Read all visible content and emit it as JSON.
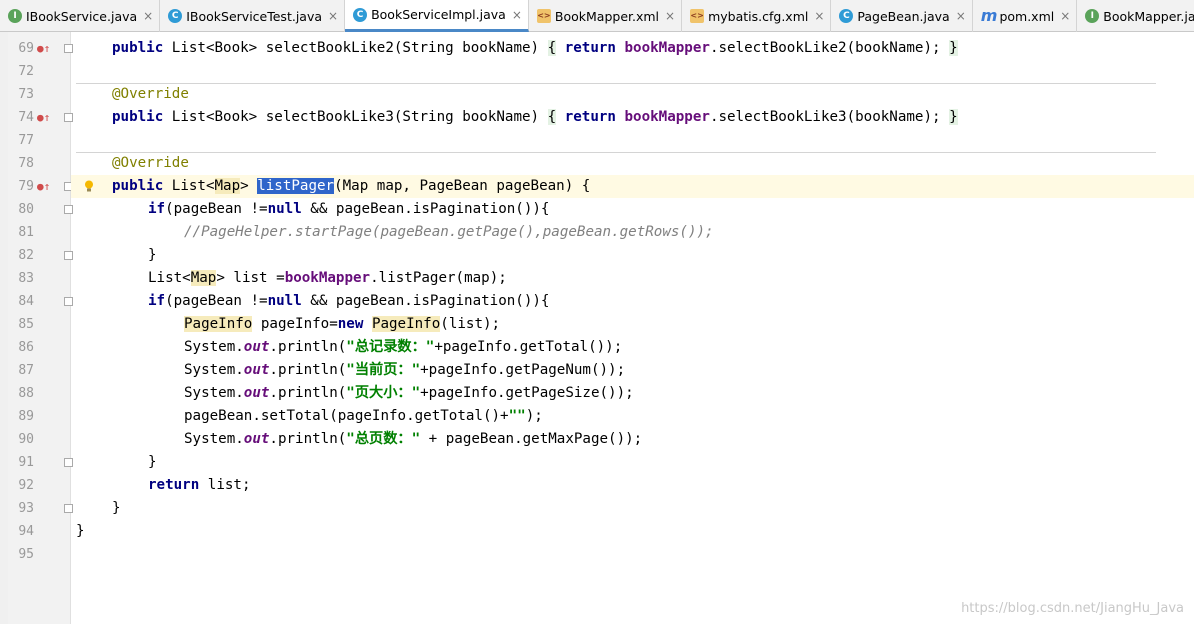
{
  "tabs": [
    {
      "label": "IBookService.java",
      "icon": "interface-icon",
      "badge": "I",
      "active": false
    },
    {
      "label": "IBookServiceTest.java",
      "icon": "class-icon",
      "badge": "C",
      "active": false
    },
    {
      "label": "BookServiceImpl.java",
      "icon": "class-icon",
      "badge": "C",
      "active": true
    },
    {
      "label": "BookMapper.xml",
      "icon": "xml-icon",
      "badge": "<>",
      "active": false
    },
    {
      "label": "mybatis.cfg.xml",
      "icon": "xml-icon",
      "badge": "<>",
      "active": false
    },
    {
      "label": "PageBean.java",
      "icon": "class-icon",
      "badge": "C",
      "active": false
    },
    {
      "label": "pom.xml",
      "icon": "maven-icon",
      "badge": "m",
      "active": false
    },
    {
      "label": "BookMapper.java",
      "icon": "interface-icon",
      "badge": "I",
      "active": false
    }
  ],
  "close_glyph": "×",
  "gutter_mark": "●↑",
  "line_numbers": [
    "69",
    "72",
    "73",
    "74",
    "77",
    "78",
    "79",
    "80",
    "81",
    "82",
    "83",
    "84",
    "85",
    "86",
    "87",
    "88",
    "89",
    "90",
    "91",
    "92",
    "93",
    "94",
    "95"
  ],
  "code": {
    "l69_a": "public",
    "l69_b": " List<Book> selectBookLike2(String bookName) ",
    "l69_c": "{",
    "l69_d": " return ",
    "l69_e": "bookMapper",
    "l69_f": ".selectBookLike2(bookName); ",
    "l69_g": "}",
    "l73": "@Override",
    "l74_a": "public",
    "l74_b": " List<Book> selectBookLike3(String bookName) ",
    "l74_c": "{",
    "l74_d": " return ",
    "l74_e": "bookMapper",
    "l74_f": ".selectBookLike3(bookName); ",
    "l74_g": "}",
    "l78": "@Override",
    "l79_a": "public",
    "l79_b": " List<",
    "l79_c": "Map",
    "l79_d": "> ",
    "l79_e": "listPager",
    "l79_f": "(Map map, PageBean pageBean) {",
    "l80_a": "if",
    "l80_b": "(pageBean !=",
    "l80_c": "null",
    "l80_d": " && pageBean.isPagination()){",
    "l81": "//PageHelper.startPage(pageBean.getPage(),pageBean.getRows());",
    "l82": "}",
    "l83_a": "List<",
    "l83_b": "Map",
    "l83_c": "> list =",
    "l83_d": "bookMapper",
    "l83_e": ".listPager(map);",
    "l84_a": "if",
    "l84_b": "(pageBean !=",
    "l84_c": "null",
    "l84_d": " && pageBean.isPagination()){",
    "l85_a": "PageInfo",
    "l85_b": " pageInfo=",
    "l85_c": "new",
    "l85_d": " ",
    "l85_e": "PageInfo",
    "l85_f": "(list);",
    "l86_a": "System.",
    "l86_b": "out",
    "l86_c": ".println(",
    "l86_d": "\"总记录数：\"",
    "l86_e": "+pageInfo.getTotal());",
    "l87_a": "System.",
    "l87_b": "out",
    "l87_c": ".println(",
    "l87_d": "\"当前页：\"",
    "l87_e": "+pageInfo.getPageNum());",
    "l88_a": "System.",
    "l88_b": "out",
    "l88_c": ".println(",
    "l88_d": "\"页大小：\"",
    "l88_e": "+pageInfo.getPageSize());",
    "l89_a": "pageBean.setTotal(pageInfo.getTotal()+",
    "l89_b": "\"\"",
    "l89_c": ");",
    "l90_a": "System.",
    "l90_b": "out",
    "l90_c": ".println(",
    "l90_d": "\"总页数：\"",
    "l90_e": " + pageBean.getMaxPage());",
    "l91": "}",
    "l92_a": "return",
    "l92_b": " list;",
    "l93": "}",
    "l94": "}"
  },
  "watermark": "https://blog.csdn.net/JiangHu_Java",
  "colors": {
    "keyword": "#000080",
    "annotation": "#808000",
    "field": "#660e7a",
    "string": "#008000",
    "comment": "#808080",
    "selection": "#2f65ca",
    "caret_line": "#fffae3"
  }
}
